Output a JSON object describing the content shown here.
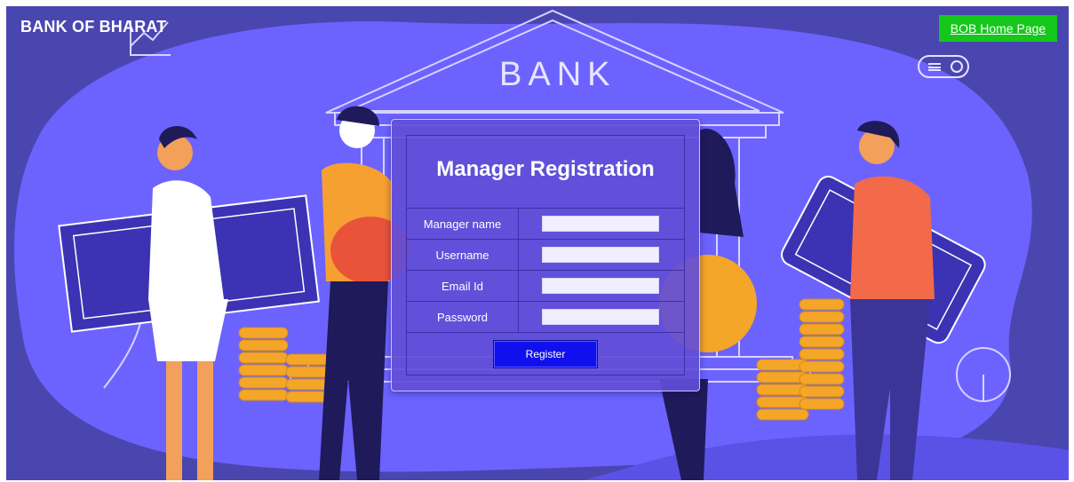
{
  "header": {
    "brand": "BANK OF BHARAT",
    "home_link": "BOB Home Page"
  },
  "illustration": {
    "bank_sign": "BANK"
  },
  "form": {
    "title": "Manager Registration",
    "fields": [
      {
        "label": "Manager name",
        "value": ""
      },
      {
        "label": "Username",
        "value": ""
      },
      {
        "label": "Email Id",
        "value": ""
      },
      {
        "label": "Password",
        "value": ""
      }
    ],
    "submit_label": "Register"
  },
  "colors": {
    "background": "#4a46b0",
    "blob": "#6c63ff",
    "panel": "#624ed7",
    "home_button": "#16c71b",
    "register_button": "#1010ee"
  }
}
